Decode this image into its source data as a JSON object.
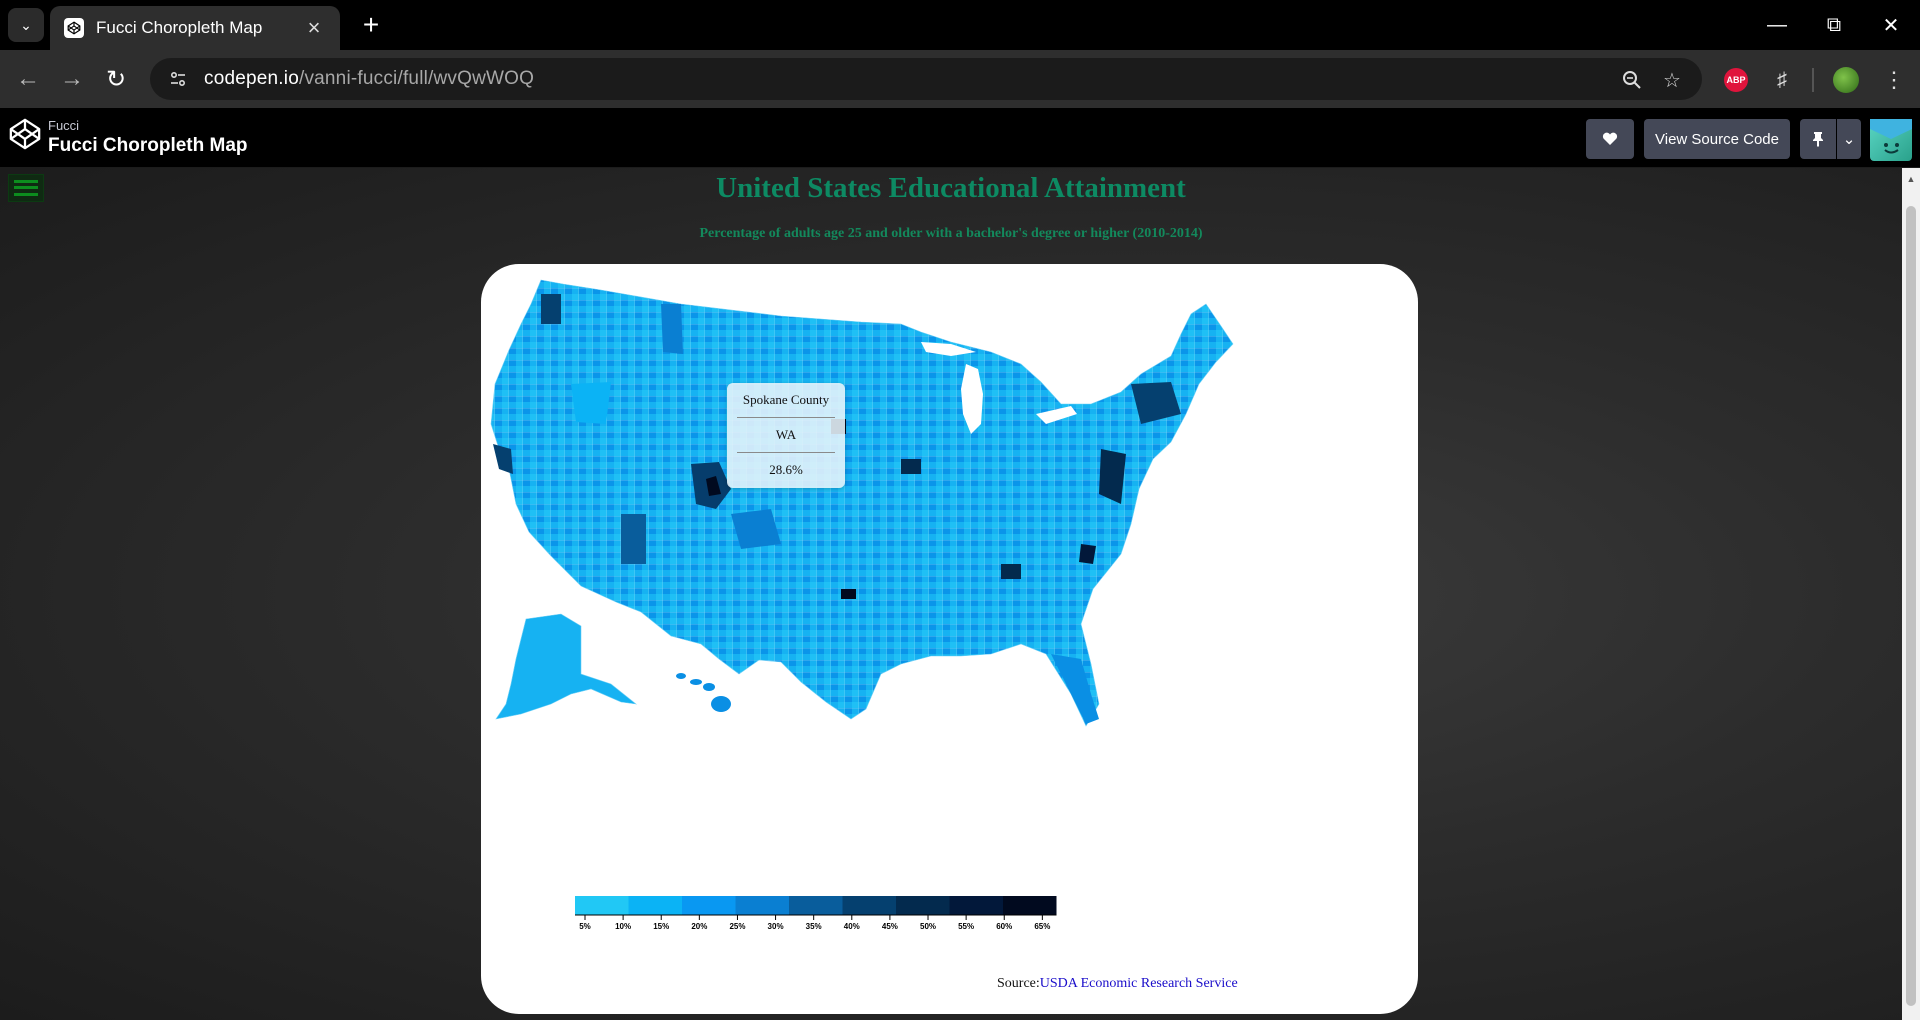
{
  "browser": {
    "tab_title": "Fucci Choropleth Map",
    "url_host": "codepen.io",
    "url_path": "/vanni-fucci/full/wvQwWOQ"
  },
  "codepen": {
    "user": "Fucci",
    "pen_title": "Fucci Choropleth Map",
    "view_source_label": "View Source Code"
  },
  "page": {
    "title": "United States Educational Attainment",
    "subtitle": "Percentage of adults age 25 and older with a bachelor's degree or higher (2010-2014)"
  },
  "tooltip": {
    "county": "Spokane County",
    "state": "WA",
    "percent": "28.6%"
  },
  "legend": {
    "colors": [
      "#21c8f5",
      "#0bb3f5",
      "#0998f2",
      "#0a7fd2",
      "#095d9c",
      "#05406f",
      "#032a4e",
      "#02183a",
      "#010a1f"
    ],
    "ticks": [
      "5%",
      "10%",
      "15%",
      "20%",
      "25%",
      "30%",
      "35%",
      "40%",
      "45%",
      "50%",
      "55%",
      "60%",
      "65%"
    ]
  },
  "source": {
    "label": "Source:",
    "link_text": "USDA Economic Research Service"
  },
  "colors": {
    "title_green": "#0d8a63",
    "map_light": "#17b9f3",
    "map_mid": "#0a8fe4",
    "map_dark": "#063d6c"
  }
}
